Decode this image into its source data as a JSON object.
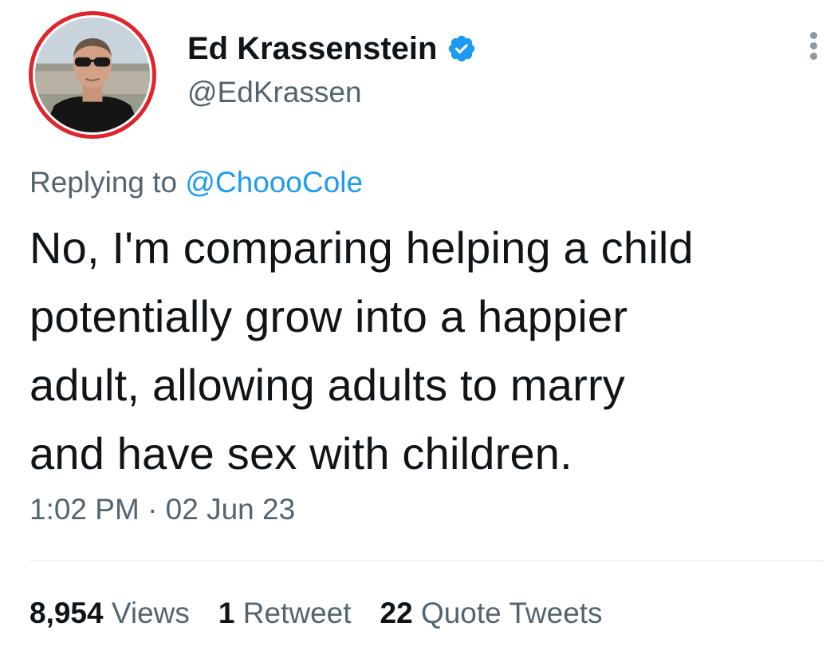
{
  "user": {
    "display_name": "Ed Krassenstein",
    "handle": "@EdKrassen",
    "verified": true,
    "verified_color": "#1d9bf0",
    "avatar_ring_color": "#e0242c"
  },
  "reply": {
    "prefix": "Replying to",
    "mention": "@ChoooCole"
  },
  "tweet": {
    "line1": "No, I'm comparing helping a child",
    "line2": "potentially grow into a happier",
    "line3": "adult, allowing adults to marry",
    "line4": "and have sex with children.",
    "timestamp": "1:02 PM · 02 Jun 23"
  },
  "stats": {
    "views_count": "8,954",
    "views_label": "Views",
    "retweets_count": "1",
    "retweets_label": "Retweet",
    "quotes_count": "22",
    "quotes_label": "Quote Tweets"
  },
  "icons": {
    "verified": "verified-badge-icon",
    "more": "more-options-icon"
  }
}
